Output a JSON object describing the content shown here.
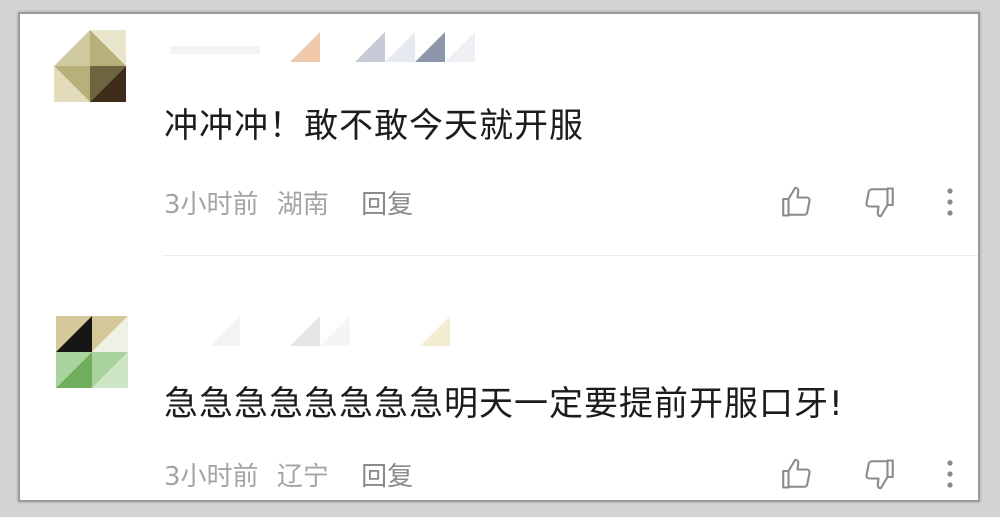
{
  "comments": [
    {
      "text": "冲冲冲！敢不敢今天就开服",
      "time": "3小时前",
      "location": "湖南",
      "reply_label": "回复",
      "avatar_colors": [
        "#b8b07a",
        "#6e6540",
        "#3d2d1a",
        "#cfc9a0",
        "#e9e4cc"
      ]
    },
    {
      "text": "急急急急急急急急明天一定要提前开服口牙!",
      "time": "3小时前",
      "location": "辽宁",
      "reply_label": "回复",
      "avatar_colors": [
        "#151515",
        "#d4c79a",
        "#6fae5a",
        "#a8d39c",
        "#eef2e6"
      ]
    }
  ],
  "icons": {
    "like": "thumbs-up-icon",
    "dislike": "thumbs-down-icon",
    "more": "more-vertical-icon"
  }
}
